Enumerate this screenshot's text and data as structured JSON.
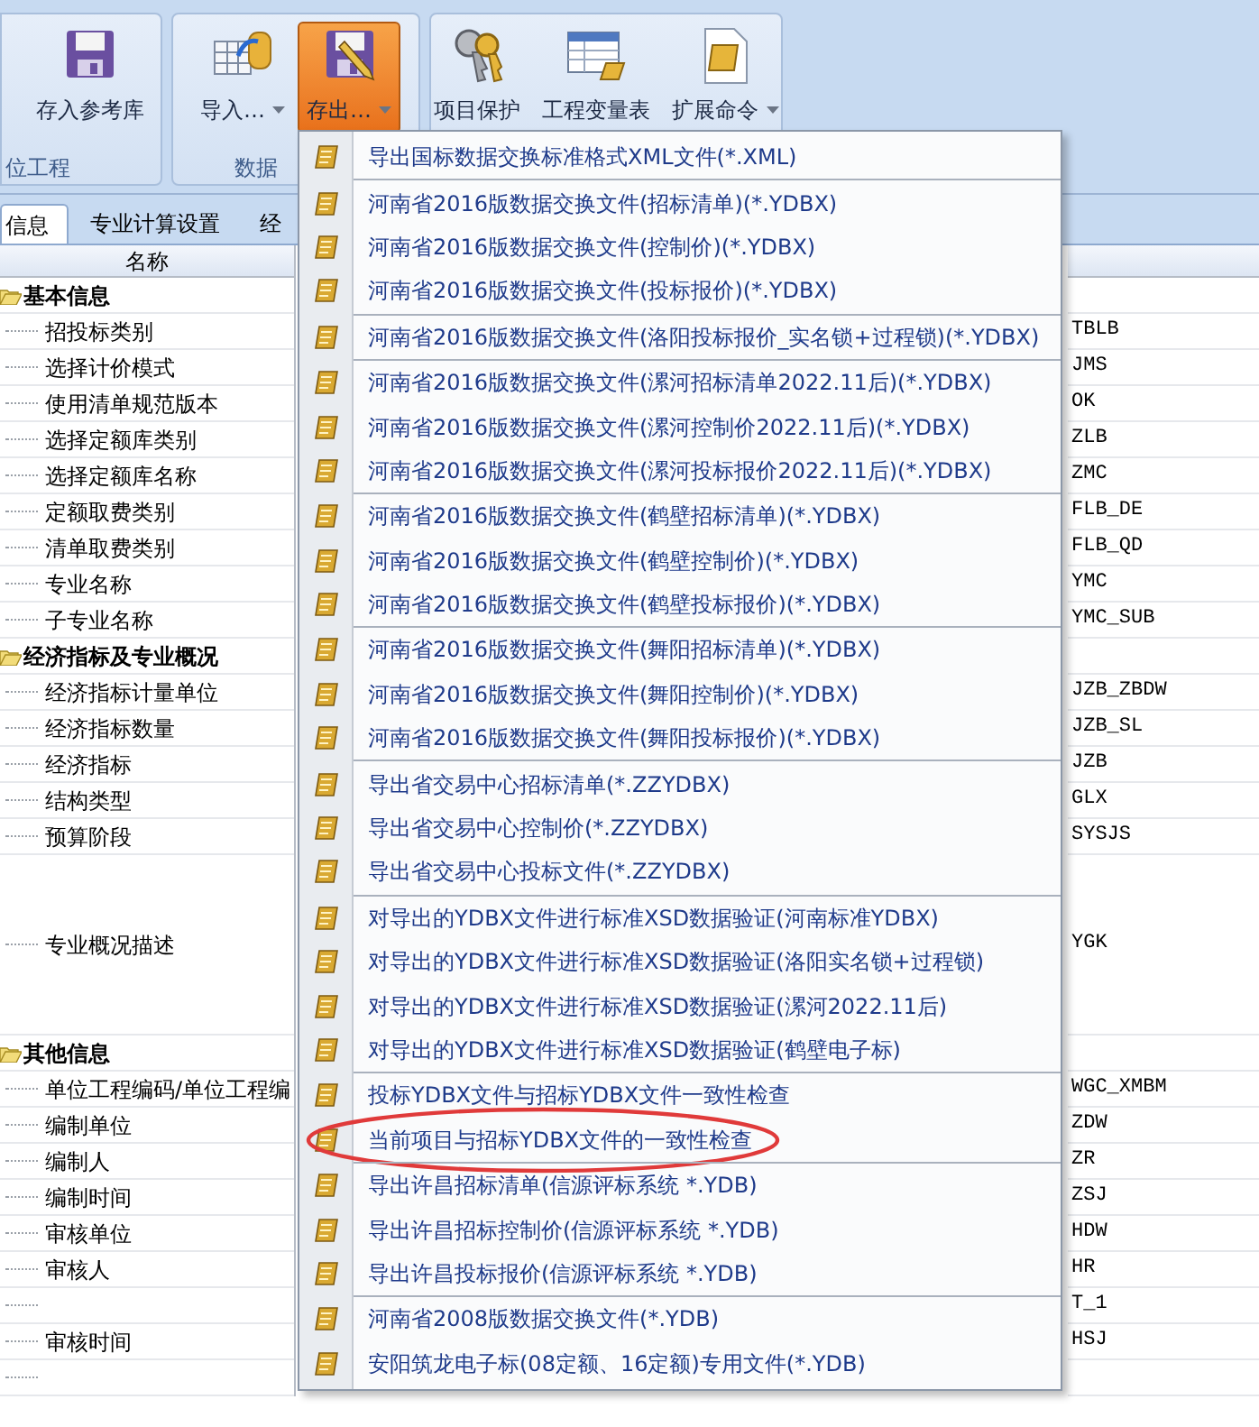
{
  "ribbon": {
    "groups": [
      {
        "label": "位工程",
        "buttons": [
          {
            "label": "存入参考库",
            "kind": "disk",
            "pressed": false,
            "dropdown": false
          }
        ]
      },
      {
        "label": "数据",
        "buttons": [
          {
            "label": "导入…",
            "kind": "import",
            "pressed": false,
            "dropdown": true
          },
          {
            "label": "存出…",
            "kind": "export",
            "pressed": true,
            "dropdown": true
          }
        ]
      },
      {
        "buttons": [
          {
            "label": "项目保护",
            "kind": "keys",
            "pressed": false,
            "dropdown": false
          },
          {
            "label": "工程变量表",
            "kind": "sheet",
            "pressed": false,
            "dropdown": false
          },
          {
            "label": "扩展命令",
            "kind": "scroll",
            "pressed": false,
            "dropdown": true
          }
        ]
      }
    ]
  },
  "tabs": [
    {
      "label": "信息",
      "selected": true
    },
    {
      "label": "专业计算设置",
      "selected": false
    },
    {
      "label": "经",
      "selected": false
    }
  ],
  "table": {
    "column_1": "名称",
    "sections": [
      {
        "title": "基本信息",
        "expanded": true,
        "rows": [
          {
            "name": "招投标类别",
            "code": "TBLB",
            "kind": "line"
          },
          {
            "name": "选择计价模式",
            "code": "JMS",
            "kind": "line"
          },
          {
            "name": "使用清单规范版本",
            "code": "OK",
            "kind": "line"
          },
          {
            "name": "选择定额库类别",
            "code": "ZLB",
            "kind": "line"
          },
          {
            "name": "选择定额库名称",
            "code": "ZMC",
            "kind": "line"
          },
          {
            "name": "定额取费类别",
            "code": "FLB_DE",
            "kind": "line"
          },
          {
            "name": "清单取费类别",
            "code": "FLB_QD",
            "kind": "line"
          },
          {
            "name": "专业名称",
            "code": "YMC",
            "kind": "line"
          },
          {
            "name": "子专业名称",
            "code": "YMC_SUB",
            "kind": "line"
          }
        ]
      },
      {
        "title": "经济指标及专业概况",
        "expanded": true,
        "rows": [
          {
            "name": "经济指标计量单位",
            "code": "JZB_ZBDW",
            "kind": "line"
          },
          {
            "name": "经济指标数量",
            "code": "JZB_SL",
            "kind": "line"
          },
          {
            "name": "经济指标",
            "code": "JZB",
            "kind": "line"
          },
          {
            "name": "结构类型",
            "code": "GLX",
            "kind": "line"
          },
          {
            "name": "预算阶段",
            "code": "SYSJS",
            "kind": "line"
          },
          {
            "name": "专业概况描述",
            "code": "YGK",
            "kind": "memo"
          }
        ]
      },
      {
        "title": "其他信息",
        "expanded": true,
        "rows": [
          {
            "name": "单位工程编码/单位工程编",
            "code": "WGC_XMBM",
            "kind": "line"
          },
          {
            "name": "编制单位",
            "code": "ZDW",
            "kind": "line"
          },
          {
            "name": "编制人",
            "code": "ZR",
            "kind": "line"
          },
          {
            "name": "编制时间",
            "code": "ZSJ",
            "kind": "line"
          },
          {
            "name": "审核单位",
            "code": "HDW",
            "kind": "line"
          },
          {
            "name": "审核人",
            "code": "HR",
            "kind": "line"
          },
          {
            "code": "T_1",
            "kind": "line"
          },
          {
            "name": "审核时间",
            "code": "HSJ",
            "kind": "line"
          },
          {
            "kind": "line"
          }
        ]
      }
    ]
  },
  "menu": {
    "groups": [
      {
        "items": [
          {
            "label": "导出国标数据交换标准格式XML文件(*.XML)",
            "circled": false
          }
        ]
      },
      {
        "items": [
          {
            "label": "河南省2016版数据交换文件(招标清单)(*.YDBX)",
            "circled": false
          },
          {
            "label": "河南省2016版数据交换文件(控制价)(*.YDBX)",
            "circled": false
          },
          {
            "label": "河南省2016版数据交换文件(投标报价)(*.YDBX)",
            "circled": false
          }
        ]
      },
      {
        "items": [
          {
            "label": "河南省2016版数据交换文件(洛阳投标报价_实名锁+过程锁)(*.YDBX)",
            "circled": false
          }
        ]
      },
      {
        "items": [
          {
            "label": "河南省2016版数据交换文件(漯河招标清单2022.11后)(*.YDBX)",
            "circled": false
          },
          {
            "label": "河南省2016版数据交换文件(漯河控制价2022.11后)(*.YDBX)",
            "circled": false
          },
          {
            "label": "河南省2016版数据交换文件(漯河投标报价2022.11后)(*.YDBX)",
            "circled": false
          }
        ]
      },
      {
        "items": [
          {
            "label": "河南省2016版数据交换文件(鹤壁招标清单)(*.YDBX)",
            "circled": false
          },
          {
            "label": "河南省2016版数据交换文件(鹤壁控制价)(*.YDBX)",
            "circled": false
          },
          {
            "label": "河南省2016版数据交换文件(鹤壁投标报价)(*.YDBX)",
            "circled": false
          }
        ]
      },
      {
        "items": [
          {
            "label": "河南省2016版数据交换文件(舞阳招标清单)(*.YDBX)",
            "circled": false
          },
          {
            "label": "河南省2016版数据交换文件(舞阳控制价)(*.YDBX)",
            "circled": false
          },
          {
            "label": "河南省2016版数据交换文件(舞阳投标报价)(*.YDBX)",
            "circled": false
          }
        ]
      },
      {
        "items": [
          {
            "label": "导出省交易中心招标清单(*.ZZYDBX)",
            "circled": false
          },
          {
            "label": "导出省交易中心控制价(*.ZZYDBX)",
            "circled": false
          },
          {
            "label": "导出省交易中心投标文件(*.ZZYDBX)",
            "circled": false
          }
        ]
      },
      {
        "items": [
          {
            "label": "对导出的YDBX文件进行标准XSD数据验证(河南标准YDBX)",
            "circled": false
          },
          {
            "label": "对导出的YDBX文件进行标准XSD数据验证(洛阳实名锁+过程锁)",
            "circled": false
          },
          {
            "label": "对导出的YDBX文件进行标准XSD数据验证(漯河2022.11后)",
            "circled": false
          },
          {
            "label": "对导出的YDBX文件进行标准XSD数据验证(鹤壁电子标)",
            "circled": false
          }
        ]
      },
      {
        "items": [
          {
            "label": "投标YDBX文件与招标YDBX文件一致性检查",
            "circled": false
          },
          {
            "label": "当前项目与招标YDBX文件的一致性检查",
            "circled": true
          }
        ]
      },
      {
        "items": [
          {
            "label": "导出许昌招标清单(信源评标系统 *.YDB)",
            "circled": false
          },
          {
            "label": "导出许昌招标控制价(信源评标系统 *.YDB)",
            "circled": false
          },
          {
            "label": "导出许昌投标报价(信源评标系统 *.YDB)",
            "circled": false
          }
        ]
      },
      {
        "items": [
          {
            "label": "河南省2008版数据交换文件(*.YDB)",
            "circled": false
          },
          {
            "label": "安阳筑龙电子标(08定额、16定额)专用文件(*.YDB)",
            "circled": false
          }
        ]
      }
    ]
  }
}
